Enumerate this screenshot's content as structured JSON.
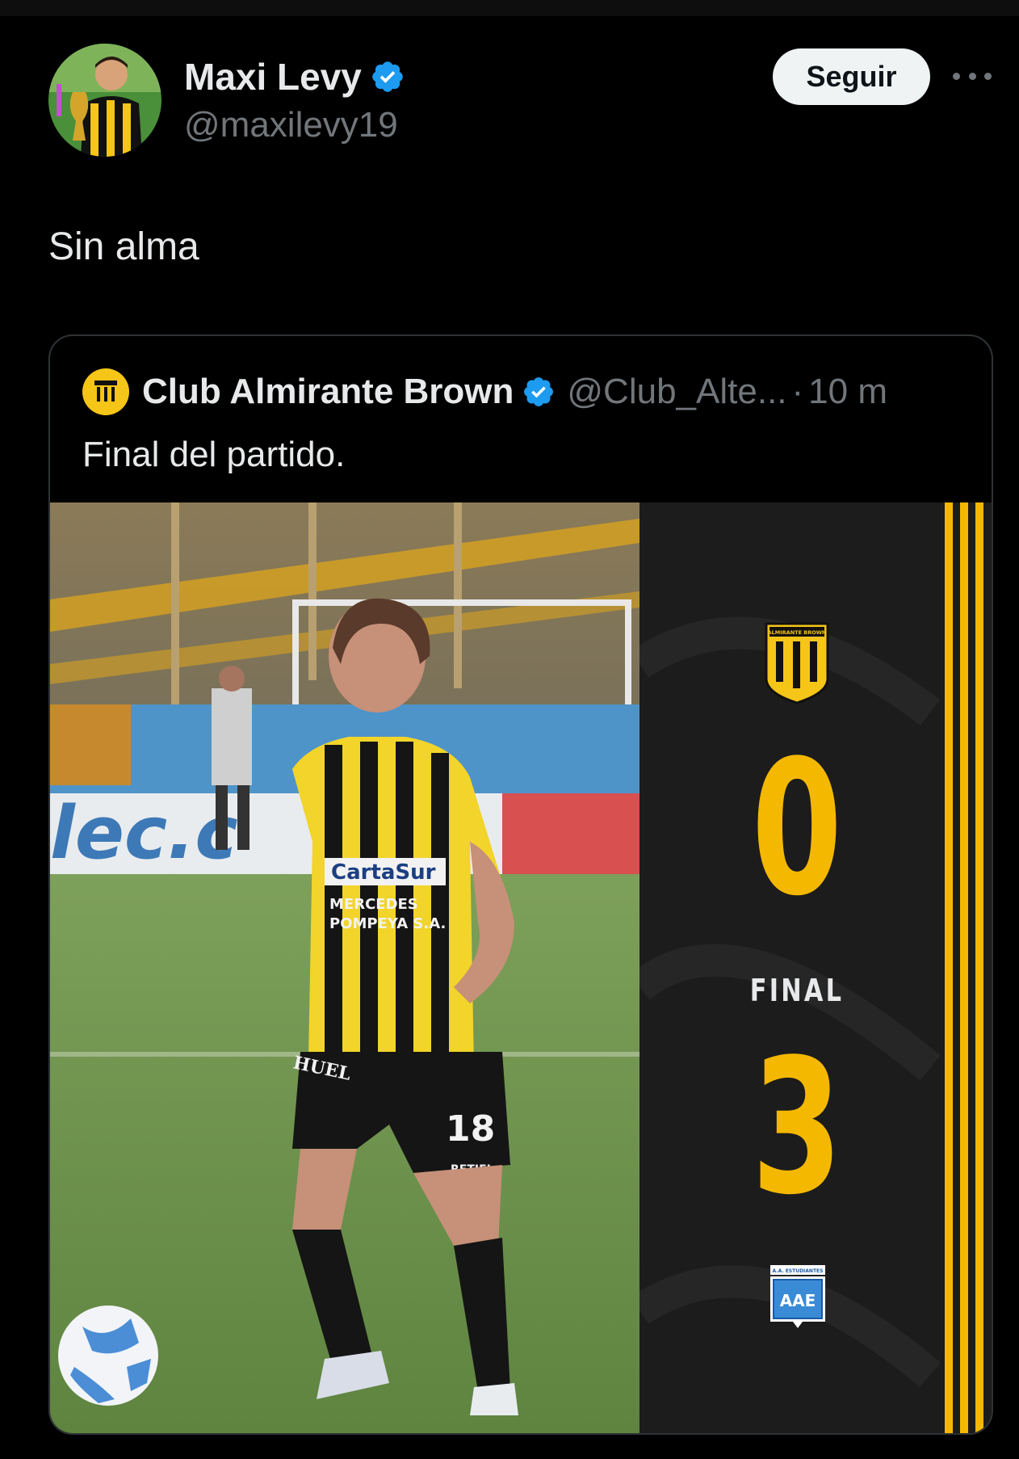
{
  "author": {
    "display_name": "Maxi Levy",
    "handle": "@maxilevy19",
    "verified": true,
    "avatar": "avatar-photo"
  },
  "actions": {
    "follow_label": "Seguir",
    "more_icon": "more-icon"
  },
  "tweet": {
    "text": "Sin alma"
  },
  "quoted": {
    "display_name": "Club Almirante Brown",
    "handle": "@Club_Alte...",
    "separator": "·",
    "time": "10 m",
    "text": "Final del partido.",
    "media": {
      "home_crest_text": "ALMIRANTE BROWN",
      "home_score": "0",
      "status": "FINAL",
      "away_score": "3",
      "away_crest_text": "A.A. ESTUDIANTES",
      "away_crest_monogram": "AAE",
      "player_number": "18",
      "shirt_sponsor_1": "CartaSur",
      "shirt_sponsor_2": "MERCEDES",
      "shirt_sponsor_3": "POMPEYA S.A.",
      "board_text": "lec.c",
      "shorts_text": "HUEL",
      "shorts_logo": "RETIEL"
    }
  },
  "colors": {
    "background": "#000000",
    "text": "#e7e9ea",
    "secondary_text": "#71767b",
    "verified_blue": "#1d9bf0",
    "accent_yellow": "#f5b800",
    "border": "#2f3336"
  }
}
